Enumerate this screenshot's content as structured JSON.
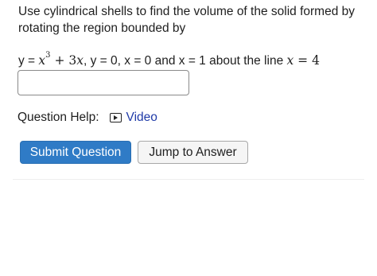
{
  "question": {
    "prompt": "Use cylindrical shells to find the volume of the solid formed by rotating the region bounded by",
    "equation": {
      "y_label": "y = ",
      "x_var": "x",
      "exponent": "3",
      "plus_term": " + 3",
      "x_var2": "x",
      "after_expr": ", y = 0, x = 0 and x = 1 about the line ",
      "line_var": "x",
      "line_eq": " = 4"
    }
  },
  "answer": {
    "value": "",
    "placeholder": ""
  },
  "help": {
    "label": "Question Help:",
    "video_label": "Video",
    "video_icon": "play-video-icon"
  },
  "buttons": {
    "submit_label": "Submit Question",
    "jump_label": "Jump to Answer"
  },
  "colors": {
    "submit_bg": "#2f7bc6",
    "link": "#1f3aa8"
  }
}
